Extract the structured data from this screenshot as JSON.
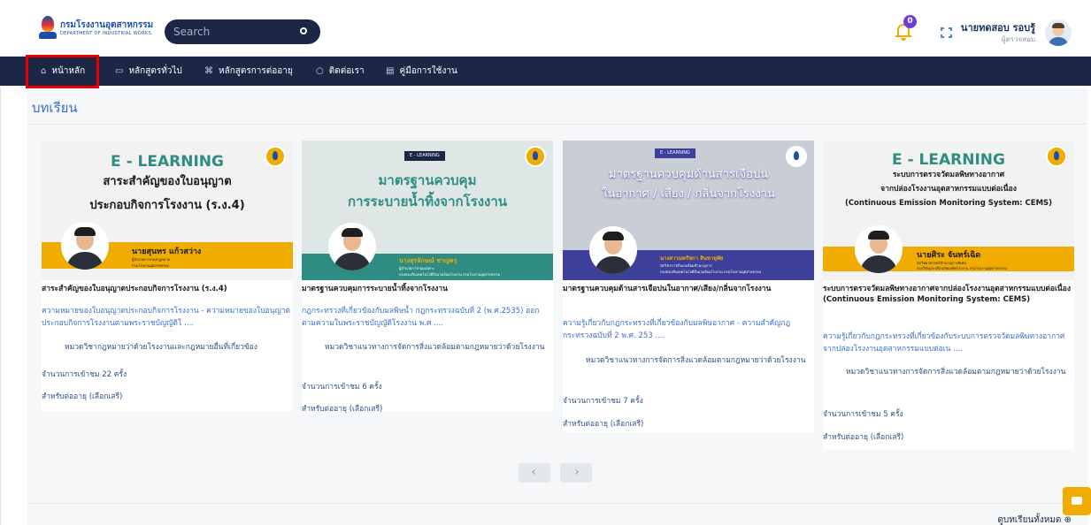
{
  "header": {
    "logo_th": "กรมโรงงานอุตสาหกรรม",
    "logo_en": "DEPARTMENT OF INDUSTRIAL WORKS",
    "search_placeholder": "Search",
    "notification_count": "0",
    "user_name": "นายทดสอบ รอบรู้",
    "user_role": "ผู้ตรวจสอบ"
  },
  "nav": {
    "items": [
      {
        "label": "หน้าหลัก",
        "icon": "home-icon"
      },
      {
        "label": "หลักสูตรทั่วไป",
        "icon": "book-icon"
      },
      {
        "label": "หลักสูตรการต่ออายุ",
        "icon": "command-icon"
      },
      {
        "label": "ติดต่อเรา",
        "icon": "chat-icon"
      },
      {
        "label": "คู่มือการใช้งาน",
        "icon": "manual-icon"
      }
    ]
  },
  "section": {
    "title": "บทเรียน"
  },
  "cards": [
    {
      "banner": {
        "elearning": "E - LEARNING",
        "line1": "สาระสำคัญของใบอนุญาต",
        "line2": "ประกอบกิจการโรงงาน (ร.ง.4)",
        "presenter": "นายสุนทร แก้วสว่าง",
        "presenter_sub1": "ผู้อำนวยการกองกฎหมาย",
        "presenter_sub2": "กรมโรงงานอุตสาหกรรม",
        "bg": "#f2f2f2",
        "accent": "#f0ac00",
        "title_color": "#1b1b1b"
      },
      "title": "สาระสำคัญของใบอนุญาตประกอบกิจการโรงงาน (ร.ง.4)",
      "description": "ความหมายของใบอนุญาตประกอบกิจการโรงงาน - ความหมายของใบอนุญาตประกอบกิจการโรงงานตามพระราชบัญญัติโ ....",
      "category": "หมวดวิชากฎหมายว่าด้วยโรงงานและกฎหมายอื่นที่เกี่ยวข้อง",
      "visits": "จำนวนการเข้าชม 22 ครั้ง",
      "type": "สำหรับต่ออายุ (เลือกเสรี)"
    },
    {
      "banner": {
        "elearning": "E - LEARNING",
        "line1": "มาตรฐานควบคุม",
        "line2": "การระบายน้ำทิ้งจากโรงงาน",
        "presenter": "นางสุรลักษณ์ ชาญครุ",
        "presenter_sub1": "ผู้อำนวยการกลุ่มเฉพาะ",
        "presenter_sub2": "กองส่งเสริมเทคโนโลยีสิ่งแวดล้อมโรงงาน กรมโรงงานอุตสาหกรรม",
        "bg": "#dfe7e6",
        "accent": "#2e8d82",
        "title_color": "#2e8d82"
      },
      "title": "มาตรฐานควบคุมการระบายน้ำทิ้งจากโรงงาน",
      "description": "กฎกระทรวงที่เกี่ยวข้องกับมลพิษน้ำ กฎกระทรวงฉบับที่ 2 (พ.ศ.2535) ออกตามความในพระราชบัญญัติโรงงาน พ.ศ ....",
      "category": "หมวดวิชาแนวทางการจัดการสิ่งแวดล้อมตามกฎหมายว่าด้วยโรงงาน",
      "visits": "จำนวนการเข้าชม 6 ครั้ง",
      "type": "สำหรับต่ออายุ (เลือกเสรี)"
    },
    {
      "banner": {
        "elearning": "E - LEARNING",
        "line1": "มาตรฐานควบคุมด้านสารเจือปน",
        "line2": "ในอากาศ / เสียง / กลิ่นจากโรงงาน",
        "presenter": "นางสาวนพรัชกา สินทายุพัย",
        "presenter_sub1": "นักวิชาการสิ่งแวดล้อมชำนาญการ",
        "presenter_sub2": "กองส่งเสริมเทคโนโลยีสิ่งแวดล้อมโรงงาน กรมโรงงานอุตสาหกรรม",
        "bg": "#c9ced6",
        "accent": "#3d3f9a",
        "title_color": "#ffffff"
      },
      "title": "มาตรฐานควบคุมด้านสารเจือปนในอากาศ/เสียง/กลิ่นจากโรงงาน",
      "description": "ความรู้เกี่ยวกับกฎกระทรวงที่เกี่ยวข้องกับมลพิษอากาศ - ความสำคัญกฎกระทรวงฉบับที่ 2 พ.ศ. 253 ....",
      "category": "หมวดวิชาแนวทางการจัดการสิ่งแวดล้อมตามกฎหมายว่าด้วยโรงงาน",
      "visits": "จำนวนการเข้าชม 7 ครั้ง",
      "type": "สำหรับต่ออายุ (เลือกเสรี)"
    },
    {
      "banner": {
        "elearning": "E - LEARNING",
        "line1": "ระบบการตรวจวัดมลพิษทางอากาศ",
        "line2": "จากปล่องโรงงานอุตสาหกรรมแบบต่อเนื่อง",
        "line3": "(Continuous Emission Monitoring System: CEMS)",
        "presenter": "นายศิระ จันทร์เฉิด",
        "presenter_sub1": "นักวิทยาศาสตร์ชำนาญการพิเศษ",
        "presenter_sub2": "กองวิจัยและเตือนภัยมลพิษโรงงาน กรมโรงงานอุตสาหกรรม",
        "bg": "#f2f2f2",
        "accent": "#f0ac00",
        "title_color": "#1b1b1b"
      },
      "title": "ระบบการตรวจวัดมลพิษทางอากาศจากปล่องโรงงานอุตสาหกรรมแบบต่อเนื่อง (Continuous Emission Monitoring System: CEMS)",
      "description": "ความรู้เกี่ยวกับกฎกระทรวงที่เกี่ยวข้องกับระบบการตรวจวัดมลพิษทางอากาศจากปล่องโรงงานอุตสาหกรรมแบบต่อเน ....",
      "category": "หมวดวิชาแนวทางการจัดการสิ่งแวดล้อมตามกฎหมายว่าด้วยโรงงาน",
      "visits": "จำนวนการเข้าชม 5 ครั้ง",
      "type": "สำหรับต่ออายุ (เลือกเสรี)"
    }
  ],
  "pager": {
    "prev_icon": "chevron-left-icon",
    "next_icon": "chevron-right-icon"
  },
  "view_all": "ดูบทเรียนทั้งหมด ⊕",
  "colors": {
    "nav_bg": "#1c2745",
    "accent": "#f0ac00",
    "link": "#3b6fcf",
    "highlight": "#e80000"
  }
}
